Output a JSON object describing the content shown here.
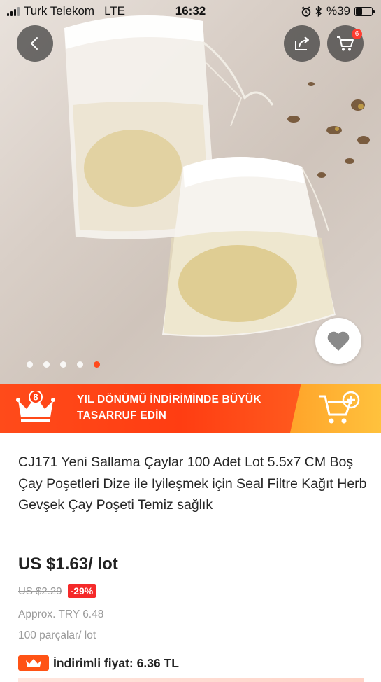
{
  "status_bar": {
    "carrier": "Turk Telekom",
    "network": "LTE",
    "time": "16:32",
    "battery": "%39",
    "battery_level": 0.39
  },
  "header": {
    "back_icon": "chevron-left-icon",
    "share_icon": "share-icon",
    "cart_icon": "cart-icon",
    "cart_count": "6"
  },
  "gallery": {
    "image_count": 5,
    "active_index": 4,
    "favorite_icon": "heart-icon"
  },
  "promo": {
    "text": "YIL DÖNÜMÜ İNDİRİMİNDE BÜYÜK TASARRUF EDİN",
    "crown_number": "8",
    "colors": {
      "banner": "#ff3d12",
      "accent": "#ffb733"
    }
  },
  "product": {
    "title": "CJ171 Yeni Sallama Çaylar 100 Adet Lot 5.5x7 CM Boş Çay Poşetleri Dize ile Iyileşmek için Seal Filtre Kağıt Herb Gevşek Çay Poşeti Temiz sağlık",
    "price": "US $1.63/ lot",
    "original_price": "US $2.29",
    "discount": "-29%",
    "approx": "Approx. TRY 6.48",
    "pieces": "100 parçalar/ lot",
    "sale_price_label": "İndirimli fiyat: 6.36 TL"
  }
}
